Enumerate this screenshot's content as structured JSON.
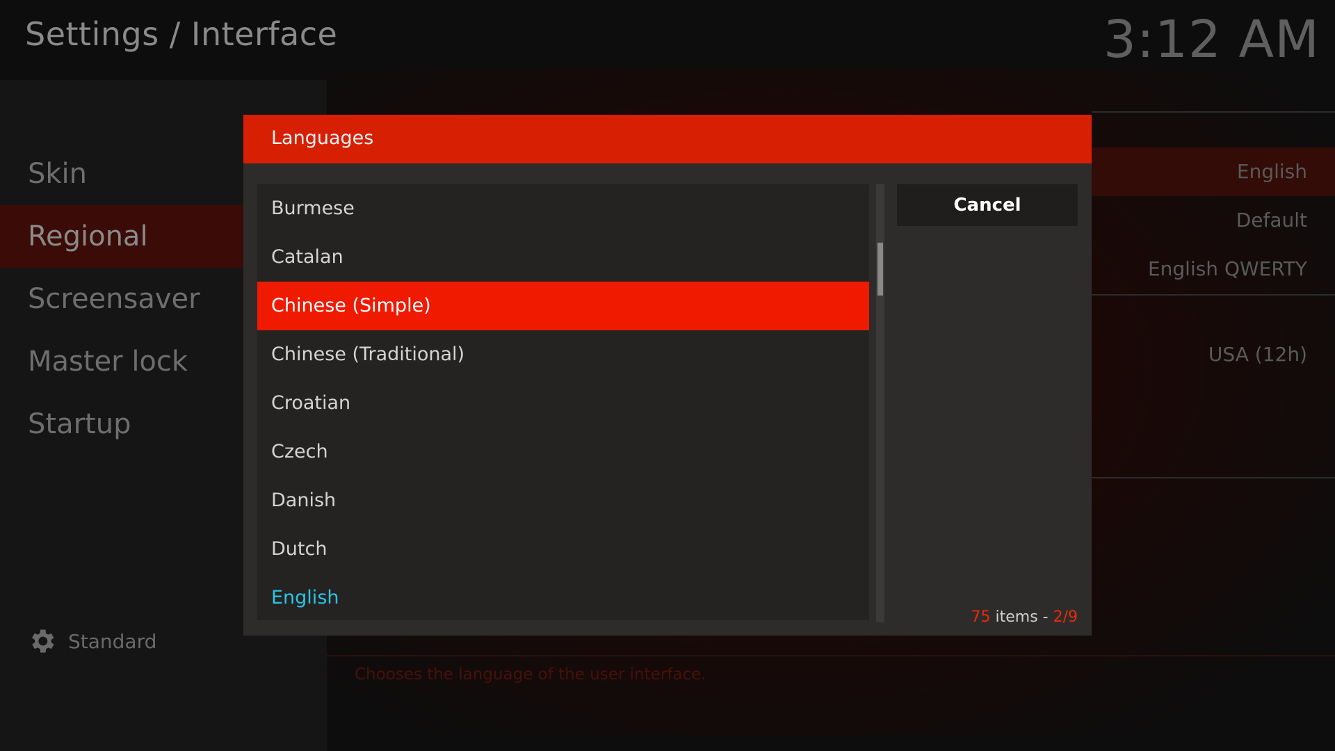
{
  "header": {
    "title": "Settings / Interface",
    "clock": "3:12 AM"
  },
  "sidebar": {
    "items": [
      {
        "label": "Skin"
      },
      {
        "label": "Regional"
      },
      {
        "label": "Screensaver"
      },
      {
        "label": "Master lock"
      },
      {
        "label": "Startup"
      }
    ],
    "settings_level": "Standard"
  },
  "background_settings": {
    "values": [
      "English",
      "Default",
      "English QWERTY",
      "USA (12h)"
    ],
    "hint": "Chooses the language of the user interface."
  },
  "dialog": {
    "title": "Languages",
    "items": [
      {
        "label": "Burmese"
      },
      {
        "label": "Catalan"
      },
      {
        "label": "Chinese (Simple)"
      },
      {
        "label": "Chinese (Traditional)"
      },
      {
        "label": "Croatian"
      },
      {
        "label": "Czech"
      },
      {
        "label": "Danish"
      },
      {
        "label": "Dutch"
      },
      {
        "label": "English"
      }
    ],
    "cancel_label": "Cancel",
    "count": {
      "total": "75",
      "items_word": "items - ",
      "page": "2/9"
    }
  },
  "colors": {
    "accent": "#ef1a00",
    "header": "#d71f04",
    "current_item": "#29c5e6"
  },
  "icons": {
    "settings_level": "gear-icon"
  }
}
